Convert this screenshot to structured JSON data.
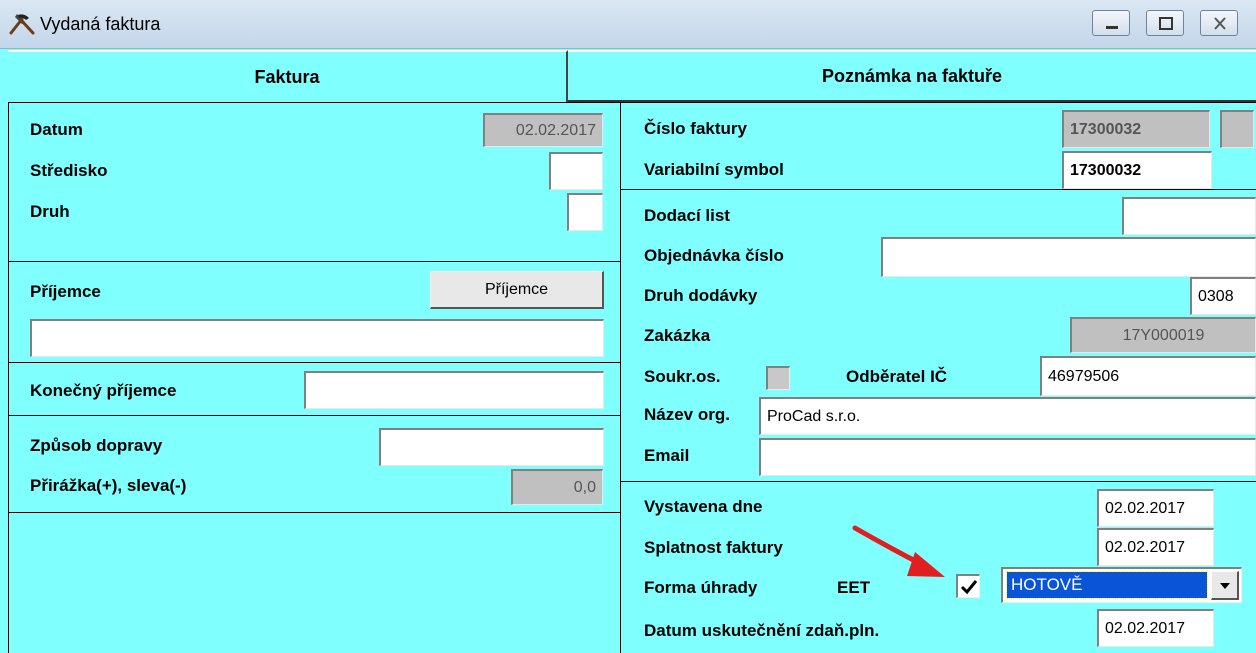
{
  "window": {
    "title": "Vydaná faktura",
    "icon": "hammer-pick-icon",
    "controls": [
      "minimize-icon",
      "maximize-icon",
      "close-icon"
    ]
  },
  "tabs": [
    {
      "label": "Faktura",
      "active": true
    },
    {
      "label": "Poznámka na faktuře",
      "active": false
    }
  ],
  "left": {
    "datum_label": "Datum",
    "datum_value": "02.02.2017",
    "stredisko_label": "Středisko",
    "stredisko_value": "",
    "druh_label": "Druh",
    "druh_value": "",
    "prijemce_label": "Příjemce",
    "prijemce_button": "Příjemce",
    "prijemce_value": "",
    "konecny_label": "Konečný příjemce",
    "konecny_value": "",
    "doprava_label": "Způsob dopravy",
    "doprava_value": "",
    "prirazka_label": "Přirážka(+), sleva(-)",
    "prirazka_value": "0,0"
  },
  "right": {
    "cislo_label": "Číslo faktury",
    "cislo_value": "17300032",
    "vs_label": "Variabilní symbol",
    "vs_value": "17300032",
    "dodaci_label": "Dodací list",
    "dodaci_value": "",
    "objednavka_label": "Objednávka číslo",
    "objednavka_value": "",
    "druh_dodavky_label": "Druh dodávky",
    "druh_dodavky_value": "0308",
    "zakazka_label": "Zakázka",
    "zakazka_value": "17Y000019",
    "soukr_label": "Soukr.os.",
    "soukr_checked": false,
    "odberatel_label": "Odběratel IČ",
    "odberatel_value": "46979506",
    "nazev_label": "Název org.",
    "nazev_value": "ProCad s.r.o.",
    "email_label": "Email",
    "email_value": "",
    "vystavena_label": "Vystavena dne",
    "vystavena_value": "02.02.2017",
    "splatnost_label": "Splatnost faktury",
    "splatnost_value": "02.02.2017",
    "forma_label": "Forma úhrady",
    "eet_label": "EET",
    "eet_checked": true,
    "forma_value": "HOTOVĚ",
    "datum_zdan_label": "Datum uskutečnění zdaň.pln.",
    "datum_zdan_value": "02.02.2017"
  },
  "colors": {
    "background": "#80ffff",
    "readonly": "#c0c0c0",
    "select_highlight": "#0a54d8",
    "arrow": "#e02020"
  }
}
